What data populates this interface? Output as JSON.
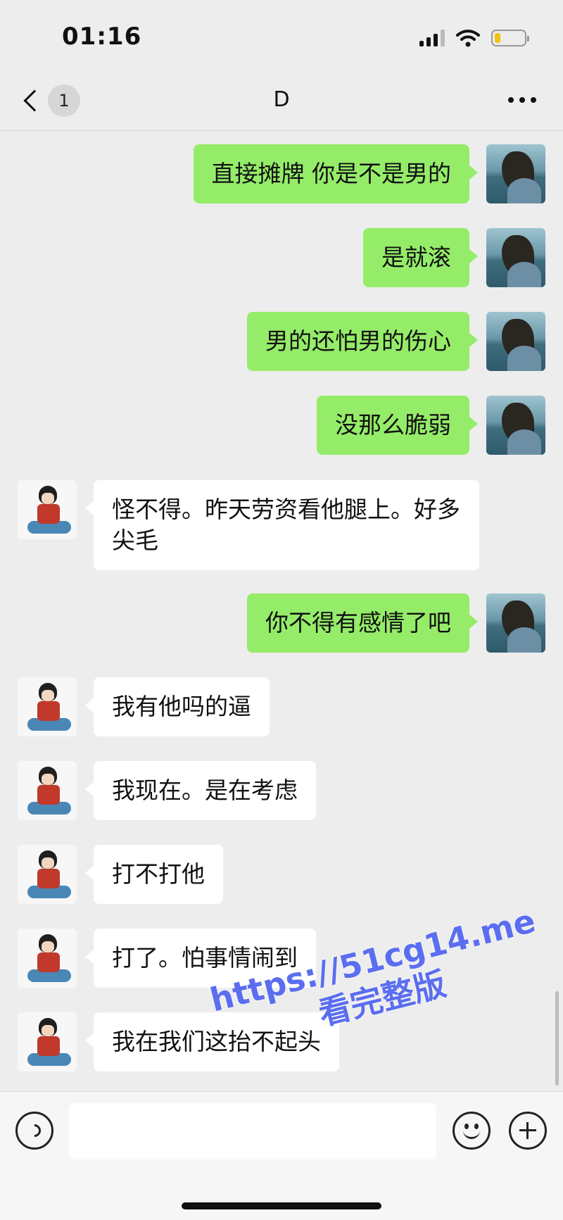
{
  "status_bar": {
    "time": "01:16",
    "battery_level": 0.2
  },
  "nav": {
    "unread_count": "1",
    "title": "D"
  },
  "messages": [
    {
      "side": "self",
      "text": "直接摊牌 你是不是男的"
    },
    {
      "side": "self",
      "text": "是就滚"
    },
    {
      "side": "self",
      "text": "男的还怕男的伤心"
    },
    {
      "side": "self",
      "text": "没那么脆弱"
    },
    {
      "side": "other",
      "text": "怪不得。昨天劳资看他腿上。好多尖毛"
    },
    {
      "side": "self",
      "text": "你不得有感情了吧"
    },
    {
      "side": "other",
      "text": "我有他吗的逼"
    },
    {
      "side": "other",
      "text": "我现在。是在考虑"
    },
    {
      "side": "other",
      "text": "打不打他"
    },
    {
      "side": "other",
      "text": "打了。怕事情闹到"
    },
    {
      "side": "other",
      "text": "我在我们这抬不起头"
    }
  ],
  "watermark": {
    "line1": "https://51cg14.me",
    "line2": "看完整版"
  },
  "input": {
    "value": ""
  },
  "colors": {
    "self_bubble": "#95ec69",
    "other_bubble": "#ffffff",
    "background": "#ededed",
    "watermark": "#5b6ef0"
  }
}
